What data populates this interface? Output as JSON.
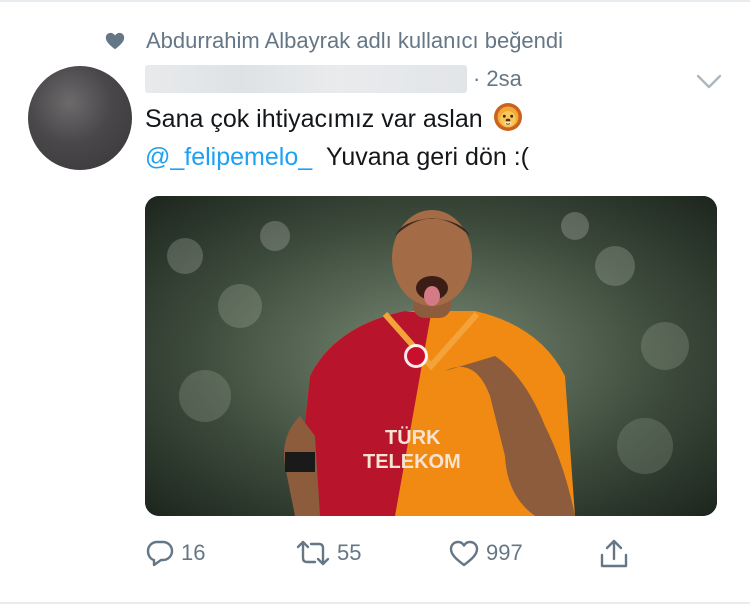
{
  "social_context": {
    "text": "Abdurrahim Albayrak adlı kullanıcı beğendi",
    "icon": "heart-icon"
  },
  "tweet": {
    "author_name": "",
    "time_separator": "·",
    "time": "2sa",
    "line1": "Sana çok ihtiyacımız var aslan",
    "line1_emoji": "lion-face",
    "mention": "@_felipemelo_",
    "line2_rest": "Yuvana geri dön :(",
    "media_caption": ""
  },
  "actions": {
    "reply_count": "16",
    "retweet_count": "55",
    "like_count": "997"
  },
  "colors": {
    "text": "#14171a",
    "secondary": "#657786",
    "link": "#1da1f2",
    "jersey_red": "#c8102e",
    "jersey_orange": "#f39200"
  }
}
